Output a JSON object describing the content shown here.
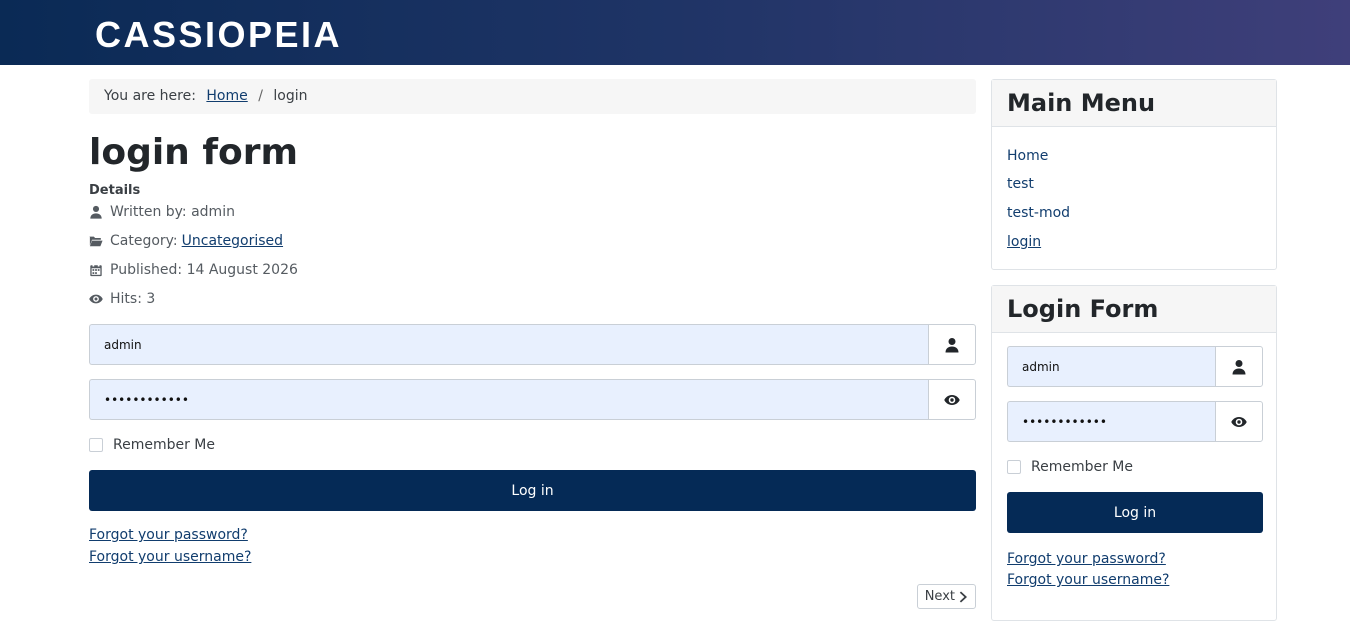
{
  "header": {
    "brand": "CASSIOPEIA"
  },
  "breadcrumb": {
    "prefix": "You are here:",
    "home": "Home",
    "separator": "/",
    "current": "login"
  },
  "article": {
    "title": "login form",
    "details_label": "Details",
    "written_by": "Written by: admin",
    "category_label": "Category:",
    "category_value": "Uncategorised",
    "published": "Published: 14 August 2026",
    "hits": "Hits: 3"
  },
  "login": {
    "username_value": "admin",
    "password_value": "••••••••••••",
    "remember_label": "Remember Me",
    "submit_label": "Log in",
    "forgot_password": "Forgot your password?",
    "forgot_username": "Forgot your username?"
  },
  "pagination": {
    "next_label": "Next"
  },
  "main_menu": {
    "title": "Main Menu",
    "items": [
      "Home",
      "test",
      "test-mod",
      "login"
    ],
    "active_item": "login"
  },
  "sidebar_login": {
    "title": "Login Form",
    "username_value": "admin",
    "password_value": "••••••••••••",
    "remember_label": "Remember Me",
    "submit_label": "Log in",
    "forgot_password": "Forgot your password?",
    "forgot_username": "Forgot your username?"
  },
  "icons": {
    "user": "user-icon",
    "folder": "folder-open-icon",
    "calendar": "calendar-icon",
    "eye": "eye-icon",
    "chevron": "chevron-right-icon"
  },
  "colors": {
    "primary": "#052a56",
    "link": "#113d6e",
    "input_fill": "#e8f0fe",
    "header_start": "#0a2a55",
    "header_end": "#3f3f7a"
  }
}
